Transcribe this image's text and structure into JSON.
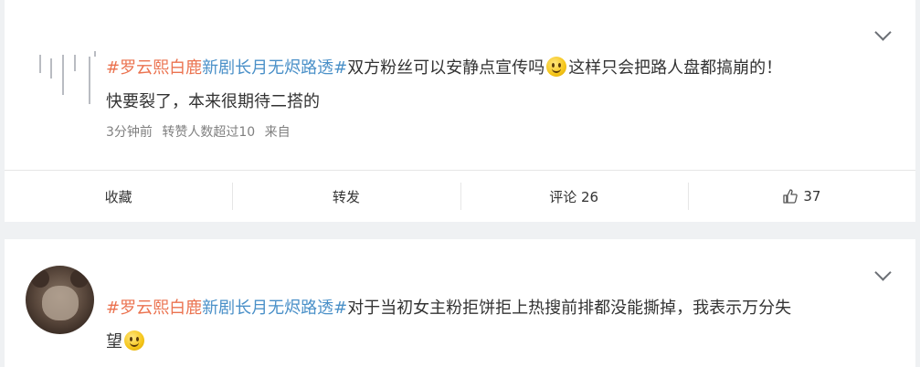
{
  "posts": [
    {
      "topic": "#罗云熙白鹿",
      "topic_rest": "新剧长月无烬路透#",
      "text_part1": "双方粉丝可以安静点宣传吗",
      "emoji": "smile-emoji",
      "text_part2": "这样只会把路人盘都搞崩的！",
      "text_line2": "快要裂了，本来很期待二搭的",
      "meta": {
        "time": "3分钟前",
        "reposts": "转赞人数超过10",
        "source": "来自"
      },
      "actions": {
        "favorite": "收藏",
        "repost": "转发",
        "comment": "评论 26",
        "like_count": "37"
      }
    },
    {
      "topic": "#罗云熙白鹿",
      "topic_rest": "新剧长月无烬路透#",
      "text_part1": "对于当初女主粉拒饼拒上热搜前排都没能撕掉，我表示万分失",
      "text_line2": "望",
      "emoji": "smile-emoji"
    }
  ],
  "colors": {
    "topic_red": "#eb7350",
    "topic_blue": "#4a90c8",
    "meta_gray": "#808080",
    "background": "#eff1f3"
  }
}
